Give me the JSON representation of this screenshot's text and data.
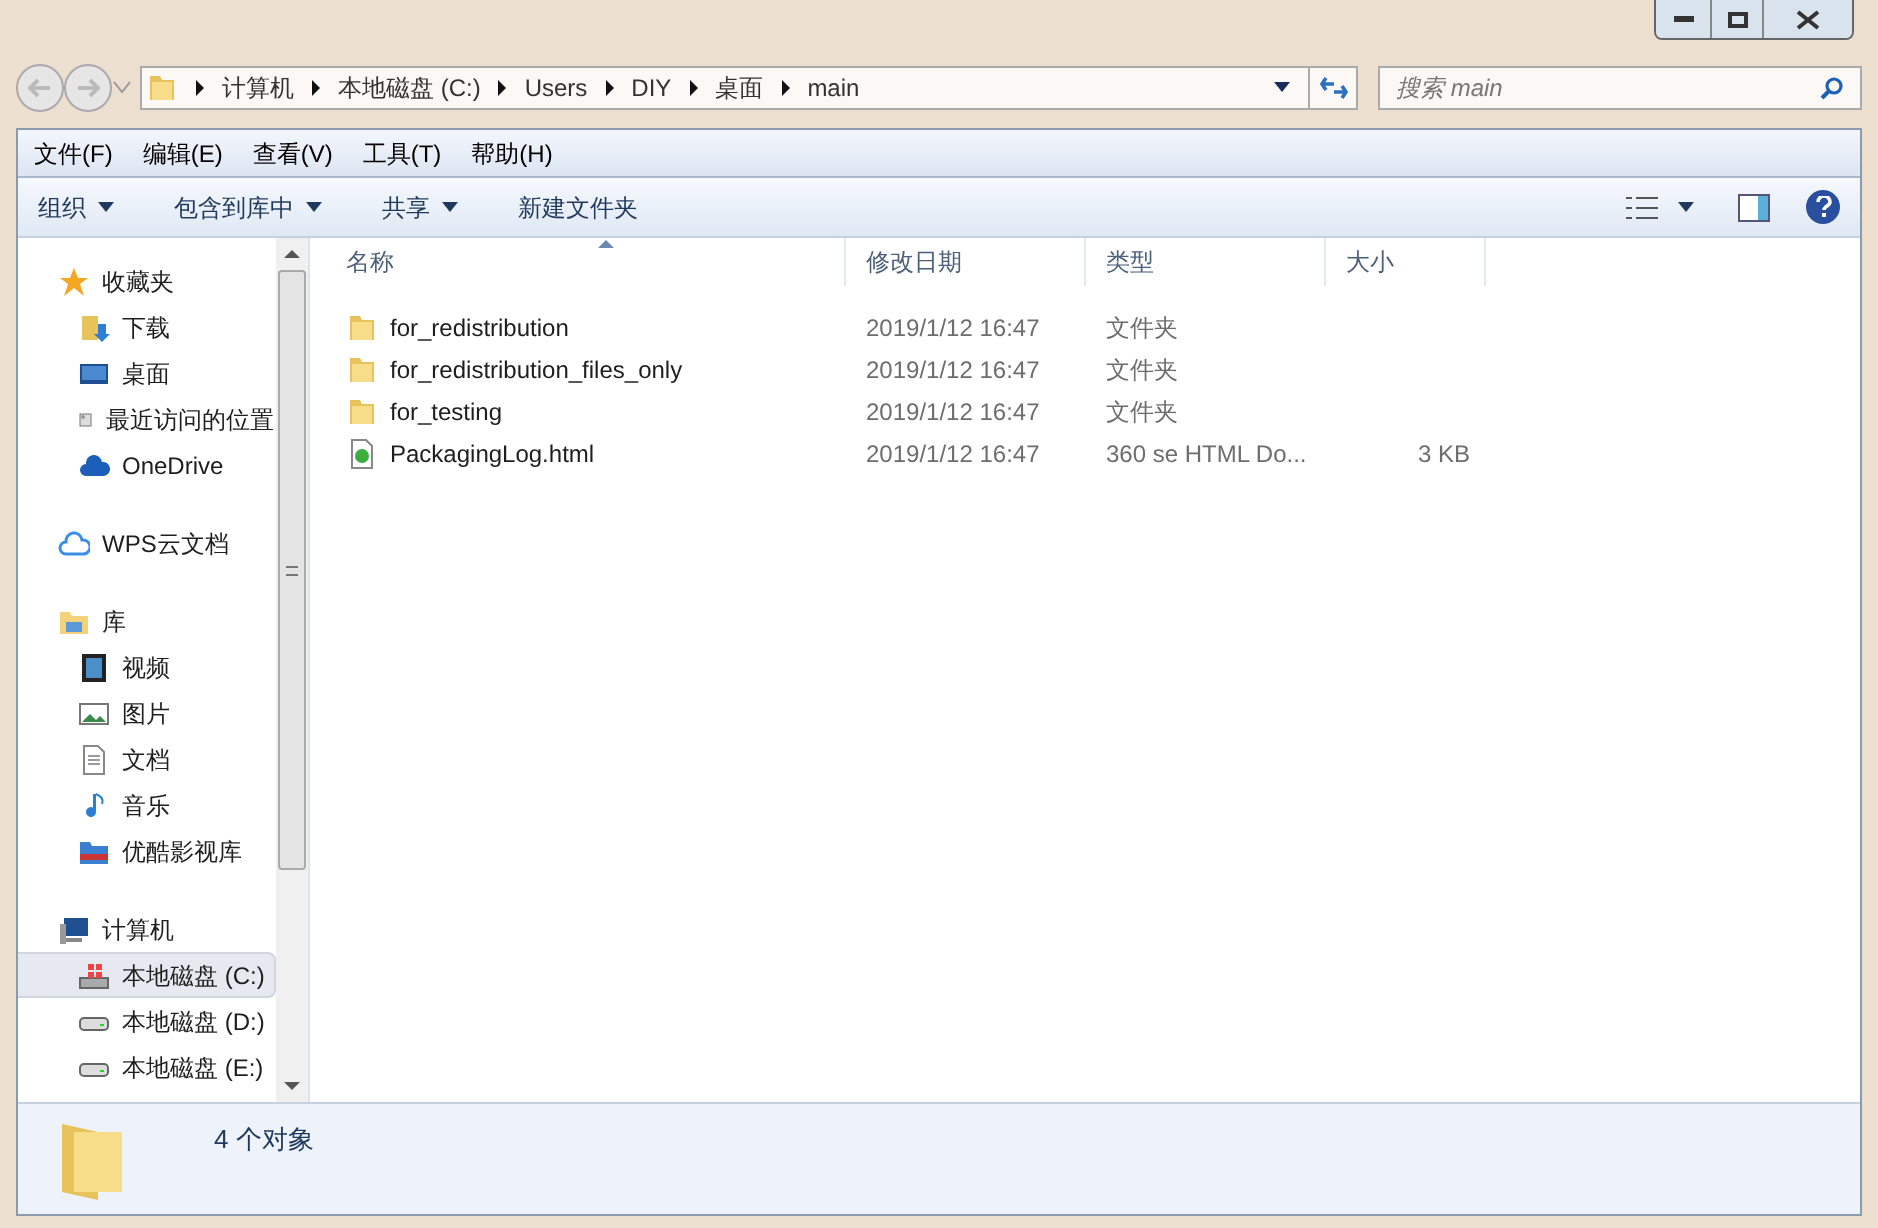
{
  "address_bar": {
    "path": [
      "计算机",
      "本地磁盘 (C:)",
      "Users",
      "DIY",
      "桌面",
      "main"
    ]
  },
  "search": {
    "placeholder": "搜索 main"
  },
  "menu_bar": [
    "文件(F)",
    "编辑(E)",
    "查看(V)",
    "工具(T)",
    "帮助(H)"
  ],
  "toolbar": [
    {
      "label": "组织",
      "dropdown": true
    },
    {
      "label": "包含到库中",
      "dropdown": true
    },
    {
      "label": "共享",
      "dropdown": true
    },
    {
      "label": "新建文件夹",
      "dropdown": false
    }
  ],
  "sidebar": {
    "items": [
      {
        "label": "收藏夹",
        "kind": "star",
        "selected": false,
        "children": [
          {
            "label": "下载",
            "kind": "download",
            "selected": false
          },
          {
            "label": "桌面",
            "kind": "desktop",
            "selected": false
          },
          {
            "label": "最近访问的位置",
            "kind": "recent",
            "selected": false
          },
          {
            "label": "OneDrive",
            "kind": "cloud",
            "selected": false
          }
        ]
      },
      {
        "label": "WPS云文档",
        "kind": "wps",
        "selected": false
      },
      {
        "label": "库",
        "kind": "library",
        "selected": false,
        "children": [
          {
            "label": "视频",
            "kind": "video",
            "selected": false
          },
          {
            "label": "图片",
            "kind": "picture",
            "selected": false
          },
          {
            "label": "文档",
            "kind": "document",
            "selected": false
          },
          {
            "label": "音乐",
            "kind": "music",
            "selected": false
          },
          {
            "label": "优酷影视库",
            "kind": "media",
            "selected": false
          }
        ]
      },
      {
        "label": "计算机",
        "kind": "computer",
        "selected": false,
        "children": [
          {
            "label": "本地磁盘 (C:)",
            "kind": "system-drive",
            "selected": true
          },
          {
            "label": "本地磁盘 (D:)",
            "kind": "drive",
            "selected": false
          },
          {
            "label": "本地磁盘 (E:)",
            "kind": "drive",
            "selected": false
          }
        ]
      }
    ]
  },
  "table": {
    "columns": [
      "名称",
      "修改日期",
      "类型",
      "大小"
    ],
    "rows": [
      {
        "kind": "folder",
        "name": "for_redistribution",
        "modified": "2019/1/12 16:47",
        "type": "文件夹"
      },
      {
        "kind": "folder",
        "name": "for_redistribution_files_only",
        "modified": "2019/1/12 16:47",
        "type": "文件夹"
      },
      {
        "kind": "folder",
        "name": "for_testing",
        "modified": "2019/1/12 16:47",
        "type": "文件夹"
      },
      {
        "kind": "html",
        "name": "PackagingLog.html",
        "modified": "2019/1/12 16:47",
        "type": "360 se HTML Do...",
        "size": "3 KB"
      }
    ]
  },
  "status_bar": {
    "count": "4 个对象"
  }
}
